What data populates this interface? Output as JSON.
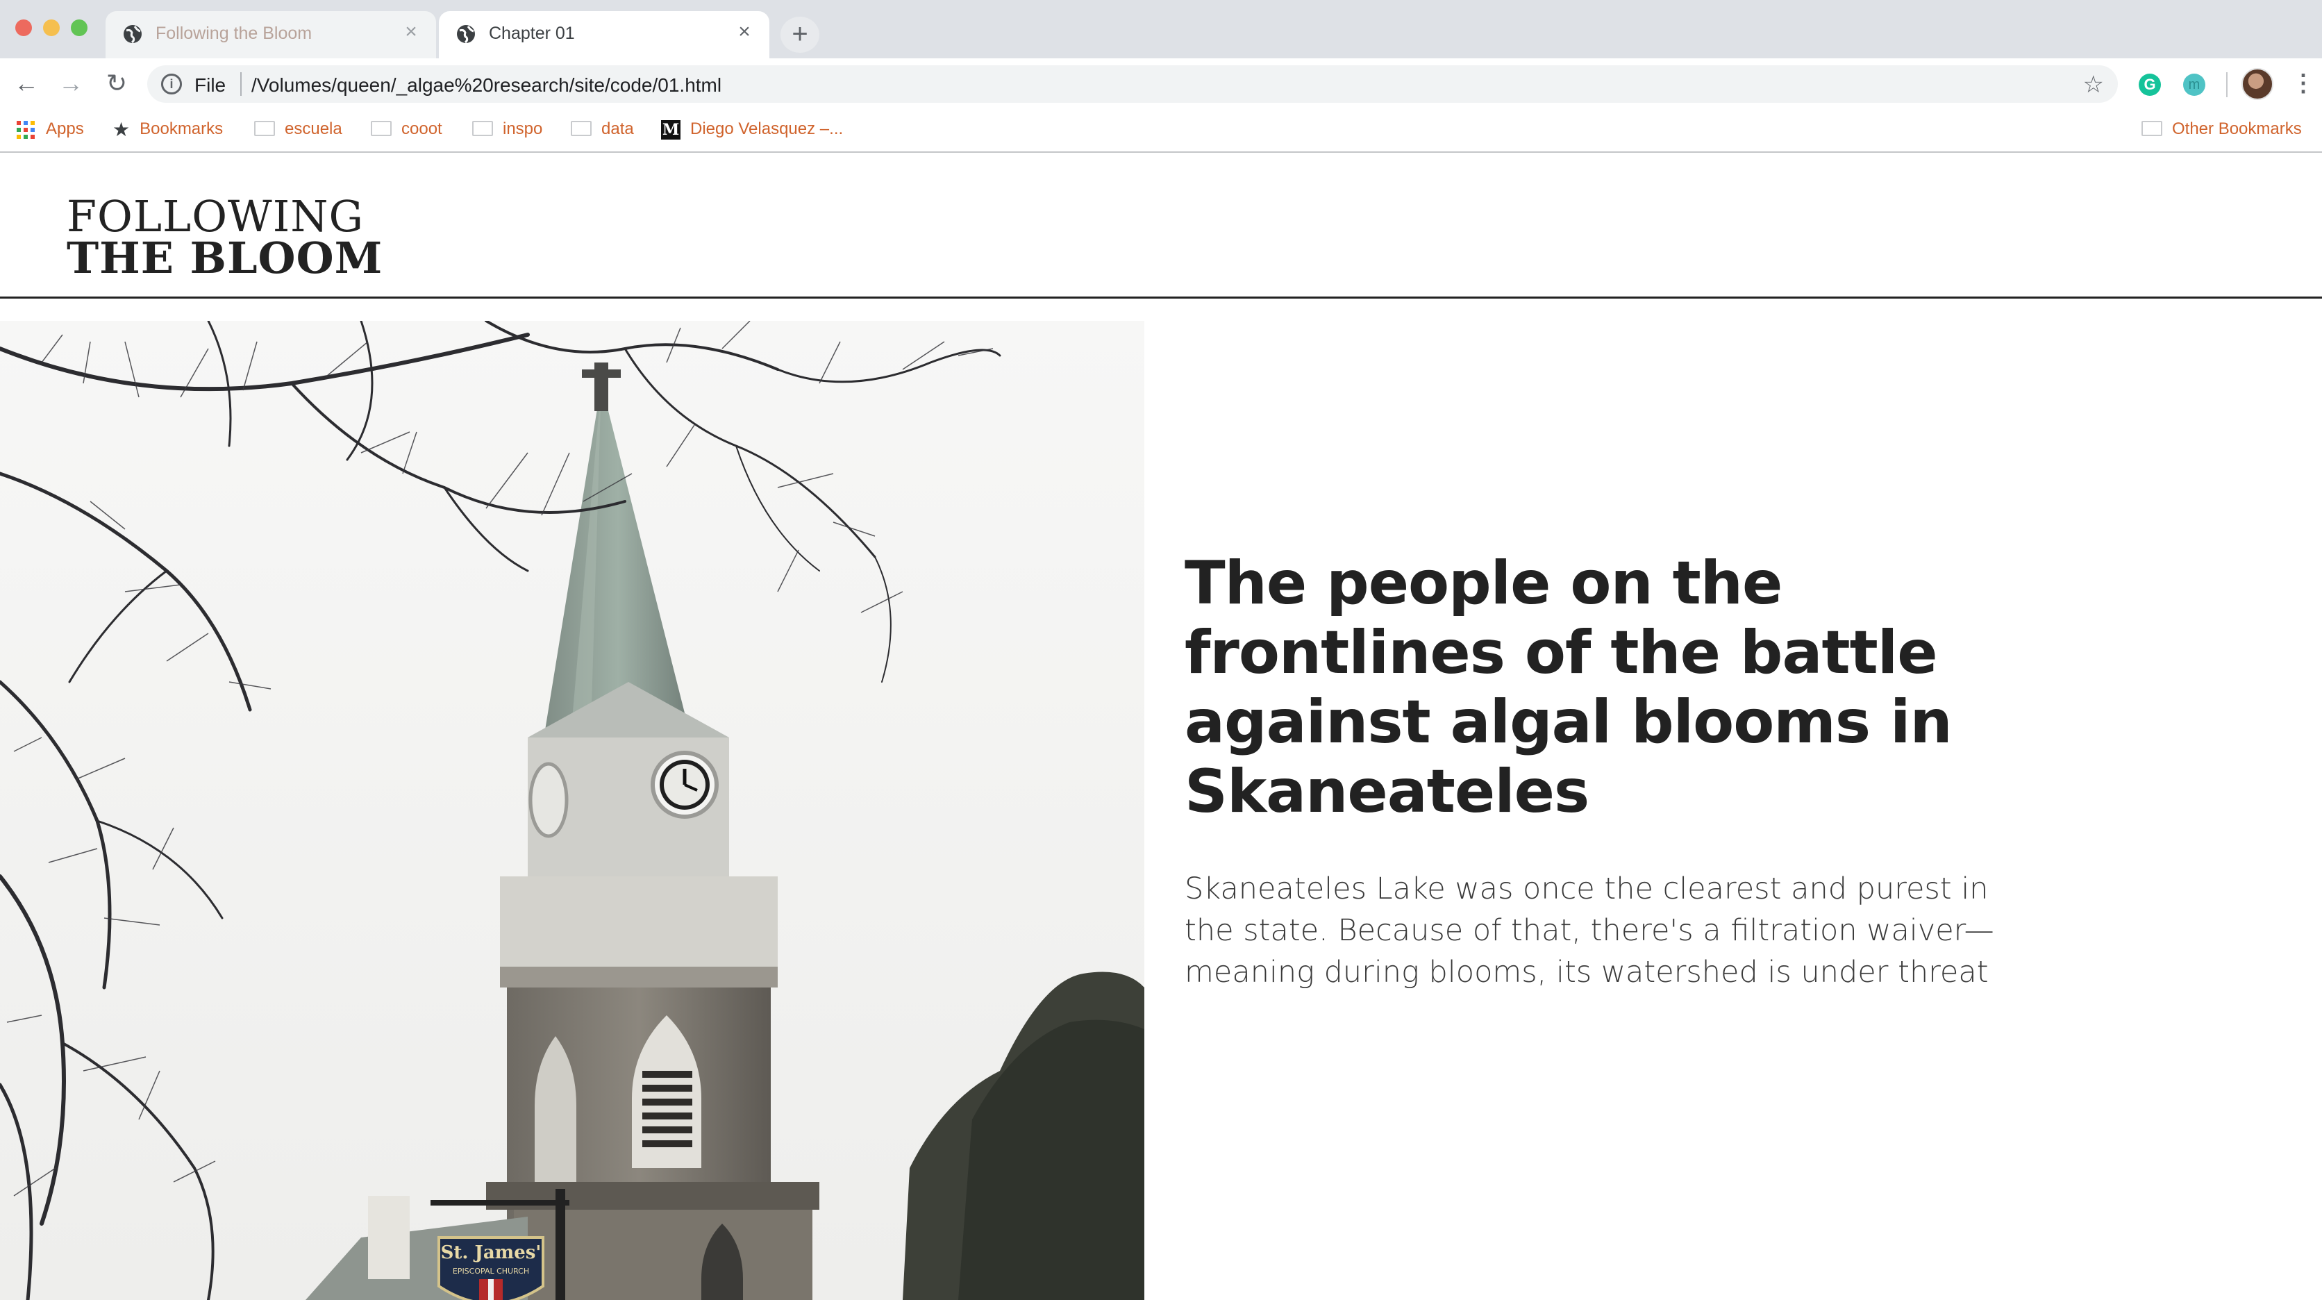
{
  "browser": {
    "tabs": [
      {
        "title": "Following the Bloom",
        "active": false
      },
      {
        "title": "Chapter 01",
        "active": true
      }
    ],
    "omnibox": {
      "scheme_label": "File",
      "url": "/Volumes/queen/_algae%20research/site/code/01.html"
    },
    "bookmarks": [
      {
        "label": "Apps",
        "icon": "apps-grid-icon"
      },
      {
        "label": "Bookmarks",
        "icon": "star-icon"
      },
      {
        "label": "escuela",
        "icon": "folder-icon"
      },
      {
        "label": "cooot",
        "icon": "folder-icon"
      },
      {
        "label": "inspo",
        "icon": "folder-icon"
      },
      {
        "label": "data",
        "icon": "folder-icon"
      },
      {
        "label": "Diego Velasquez –...",
        "icon": "medium-m-icon"
      }
    ],
    "other_bookmarks": "Other Bookmarks",
    "bookmark_color": "#d0632c"
  },
  "site": {
    "logo_line1": "FOLLOWING",
    "logo_line2": "THE BLOOM",
    "headline": "The people on the frontlines of the battle against algal blooms in Skaneateles",
    "dek": "Skaneateles Lake was once the clearest and purest in the state. Because of that, there's a filtration waiver—meaning during blooms, its watershed is under threat",
    "photo": {
      "subject": "church-steeple-photo",
      "sign_line1": "St. James'",
      "sign_line2": "EPISCOPAL CHURCH"
    }
  }
}
